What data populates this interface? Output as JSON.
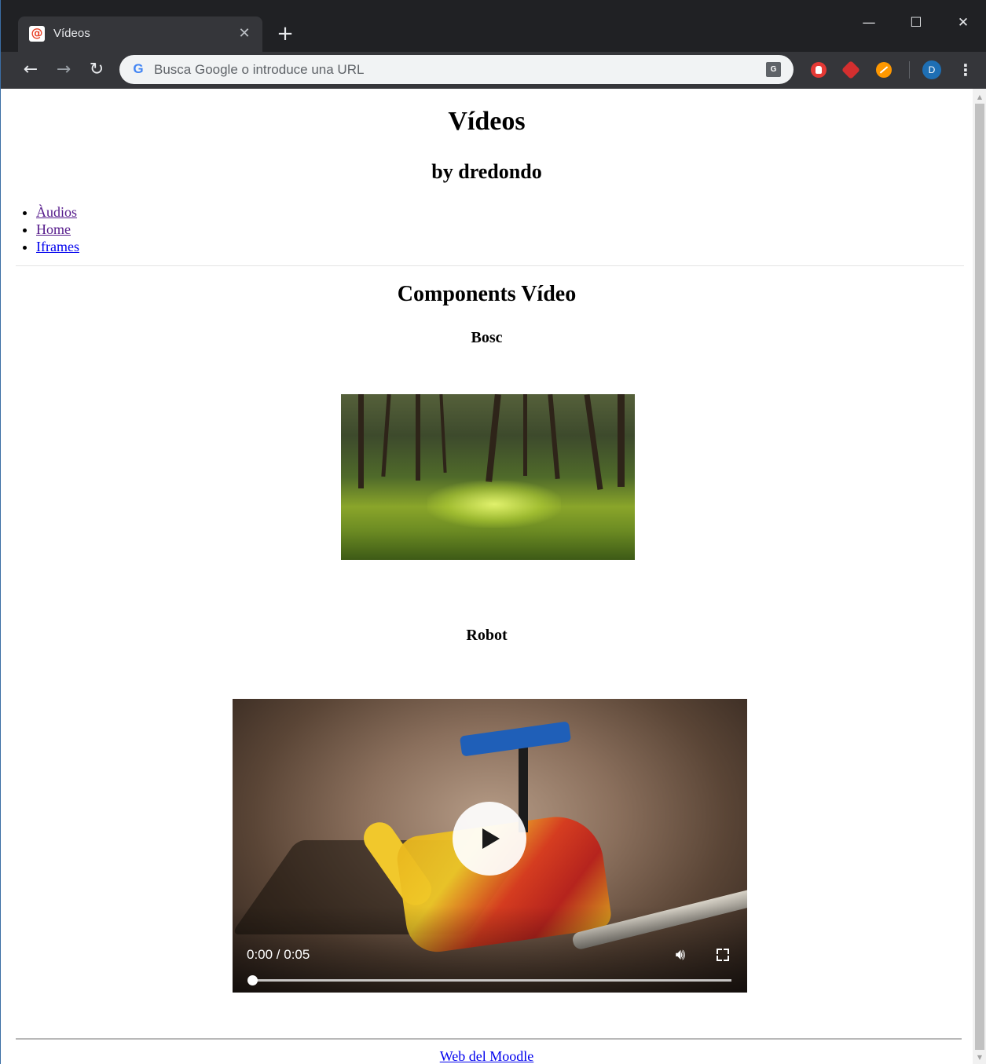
{
  "browser": {
    "tab_title": "Vídeos",
    "tab_close": "✕",
    "new_tab": "+",
    "window_minimize": "—",
    "window_maximize": "☐",
    "window_close": "✕",
    "omnibox_placeholder": "Busca Google o introduce una URL",
    "omnibox_value": "",
    "profile_initial": "D",
    "icons": {
      "favicon": "moodle-favicon-icon",
      "back": "arrow-left-icon",
      "forward": "arrow-right-icon",
      "reload": "reload-icon",
      "search_engine": "google-g-icon",
      "translate": "translate-icon",
      "extensions": [
        "adblock-icon",
        "hexagon-extension-icon",
        "orange-extension-icon"
      ],
      "menu": "vertical-dots-icon"
    }
  },
  "page": {
    "title": "Vídeos",
    "subtitle": "by dredondo",
    "nav": [
      {
        "label": "Àudios"
      },
      {
        "label": "Home"
      },
      {
        "label": "Iframes"
      }
    ],
    "section_title": "Components Vídeo",
    "videos": [
      {
        "label": "Bosc",
        "scene": "forest"
      },
      {
        "label": "Robot",
        "scene": "lego-robot",
        "time_display": "0:00 / 0:05",
        "progress": 0.0,
        "controls": [
          "play-icon",
          "volume-icon",
          "fullscreen-icon"
        ]
      }
    ],
    "footer_link": "Web del Moodle"
  },
  "colors": {
    "tabstrip": "#202124",
    "toolbar": "#35363a",
    "link_visited": "#551a8b",
    "link_unvisited": "#0000ee"
  }
}
